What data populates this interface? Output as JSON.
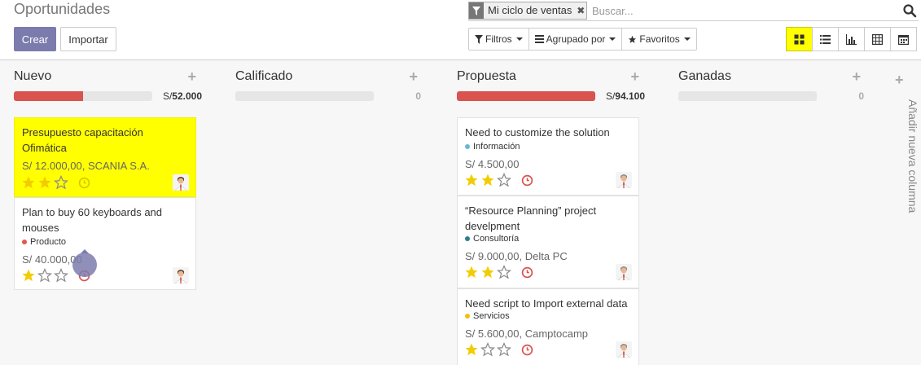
{
  "page": {
    "title": "Oportunidades"
  },
  "buttons": {
    "create": "Crear",
    "import": "Importar"
  },
  "search": {
    "facet_label": "Mi ciclo de ventas",
    "facet_remove": "✖",
    "placeholder": "Buscar..."
  },
  "dropdowns": {
    "filters": "Filtros",
    "group_by": "Agrupado por",
    "favorites": "Favoritos"
  },
  "view_switcher": {
    "active": "kanban",
    "views": [
      "kanban",
      "list",
      "graph",
      "pivot",
      "calendar"
    ]
  },
  "colors": {
    "accent": "#7c7bad",
    "highlight": "#ffff00",
    "progress_red": "#d9534f",
    "star": "#f3cc00"
  },
  "columns": [
    {
      "title": "Nuevo",
      "add": "+",
      "progress_fraction": 0.5,
      "sum_prefix": "S/",
      "sum_value": "52.000",
      "cards": [
        {
          "title": "Presupuesto capacitación Ofimática",
          "tag": "",
          "tag_color": "",
          "revenue": "S/ 12.000,00, SCANIA S.A.",
          "stars": 2,
          "highlight": true,
          "clock": "yellow"
        },
        {
          "title": "Plan to buy 60 keyboards and mouses",
          "tag": "Producto",
          "tag_color": "#e2574c",
          "revenue": "S/ 40.000,00",
          "stars": 1,
          "highlight": false,
          "clock": "red"
        }
      ]
    },
    {
      "title": "Calificado",
      "add": "+",
      "progress_fraction": 0,
      "sum_prefix": "",
      "sum_value": "0",
      "cards": []
    },
    {
      "title": "Propuesta",
      "add": "+",
      "progress_fraction": 1,
      "sum_prefix": "S/",
      "sum_value": "94.100",
      "cards": [
        {
          "title": "Need to customize the solution",
          "tag": "Información",
          "tag_color": "#6bb5d8",
          "revenue": "S/ 4.500,00",
          "stars": 2,
          "highlight": false,
          "clock": "red"
        },
        {
          "title": "“Resource Planning” project develpment",
          "tag": "Consultoría",
          "tag_color": "#2e7b8e",
          "revenue": "S/ 9.000,00, Delta PC",
          "stars": 2,
          "highlight": false,
          "clock": "red"
        },
        {
          "title": "Need script to Import external data",
          "tag": "Servicios",
          "tag_color": "#f0c010",
          "revenue": "S/ 5.600,00, Camptocamp",
          "stars": 1,
          "highlight": false,
          "clock": "red"
        }
      ]
    },
    {
      "title": "Ganadas",
      "add": "+",
      "progress_fraction": 0,
      "sum_prefix": "",
      "sum_value": "0",
      "cards": []
    }
  ],
  "add_column": {
    "plus": "+",
    "label": "Añadir nueva columna"
  }
}
